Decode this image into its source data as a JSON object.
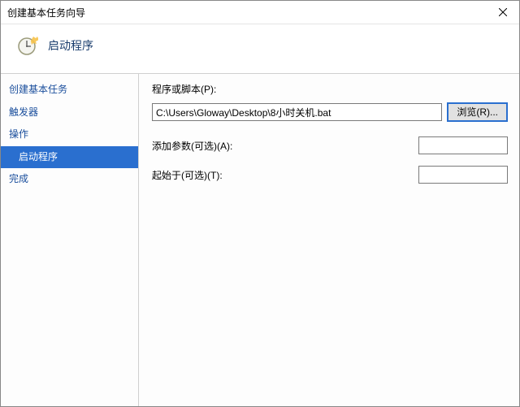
{
  "window": {
    "title": "创建基本任务向导"
  },
  "header": {
    "title": "启动程序"
  },
  "nav": {
    "items": [
      {
        "label": "创建基本任务",
        "selected": false,
        "level": 1
      },
      {
        "label": "触发器",
        "selected": false,
        "level": 1
      },
      {
        "label": "操作",
        "selected": false,
        "level": 1
      },
      {
        "label": "启动程序",
        "selected": true,
        "level": 2
      },
      {
        "label": "完成",
        "selected": false,
        "level": 1
      }
    ]
  },
  "panel": {
    "program_label": "程序或脚本(P):",
    "program_value": "C:\\Users\\Gloway\\Desktop\\8小时关机.bat",
    "browse_label": "浏览(R)...",
    "args_label": "添加参数(可选)(A):",
    "args_value": "",
    "startin_label": "起始于(可选)(T):",
    "startin_value": ""
  }
}
